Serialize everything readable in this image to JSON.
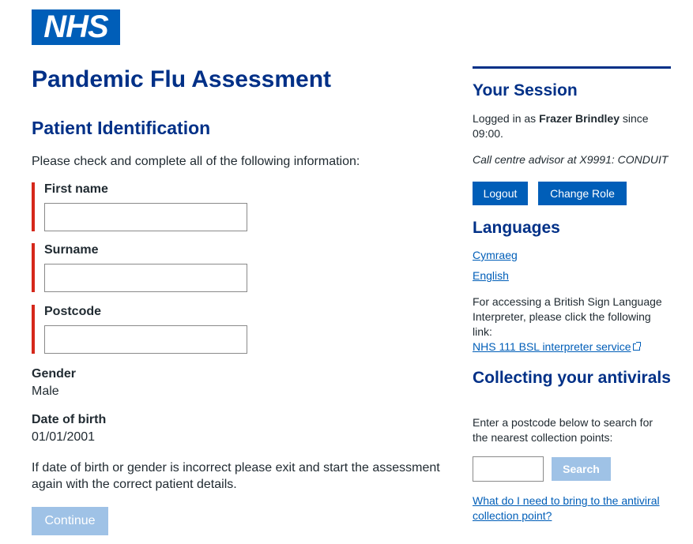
{
  "logo": {
    "text": "NHS"
  },
  "page": {
    "title": "Pandemic Flu Assessment"
  },
  "section": {
    "title": "Patient Identification",
    "intro": "Please check and complete all of the following information:"
  },
  "fields": {
    "first_name": {
      "label": "First name",
      "value": ""
    },
    "surname": {
      "label": "Surname",
      "value": ""
    },
    "postcode": {
      "label": "Postcode",
      "value": ""
    }
  },
  "gender": {
    "label": "Gender",
    "value": "Male"
  },
  "dob": {
    "label": "Date of birth",
    "value": "01/01/2001"
  },
  "note": "If date of birth or gender is incorrect please exit and start the assessment again with the correct patient details.",
  "continue_label": "Continue",
  "session": {
    "title": "Your Session",
    "logged_prefix": "Logged in as ",
    "user": "Frazer Brindley",
    "since": " since 09:00.",
    "role": "Call centre advisor at X9991: CONDUIT",
    "logout_label": "Logout",
    "change_role_label": "Change Role"
  },
  "languages": {
    "title": "Languages",
    "items": [
      "Cymraeg",
      "English"
    ],
    "bsl_text": "For accessing a British Sign Language Interpreter, please click the following link:",
    "bsl_link": "NHS 111 BSL interpreter service"
  },
  "antivirals": {
    "title": "Collecting your antivirals",
    "text": "Enter a postcode below to search for the nearest collection points:",
    "postcode_value": "",
    "search_label": "Search",
    "help_link": "What do I need to bring to the antiviral collection point?"
  }
}
